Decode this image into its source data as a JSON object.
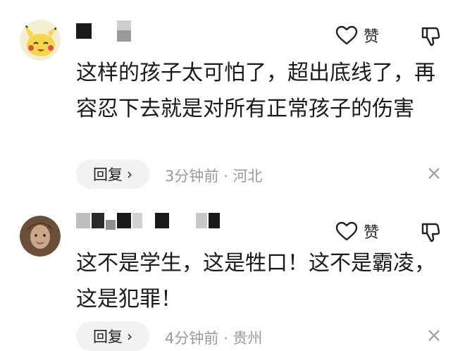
{
  "comments": [
    {
      "like_label": "赞",
      "text": "这样的孩子太可怕了，超出底线了，再容忍下去就是对所有正常孩子的伤害",
      "reply_label": "回复",
      "time": "3分钟前",
      "location": "河北",
      "avatar": "pikachu-avatar"
    },
    {
      "like_label": "赞",
      "text": "这不是学生，这是牲口！这不是霸凌，这是犯罪！",
      "reply_label": "回复",
      "time": "4分钟前",
      "location": "贵州",
      "avatar": "portrait-avatar"
    }
  ],
  "icons": {
    "like": "heart-outline-icon",
    "dislike": "thumbs-down-icon",
    "chevron": "chevron-right-icon",
    "close": "close-icon"
  },
  "colors": {
    "meta_gray": "#9a9a9a",
    "reply_bg": "#f2f2f2"
  }
}
